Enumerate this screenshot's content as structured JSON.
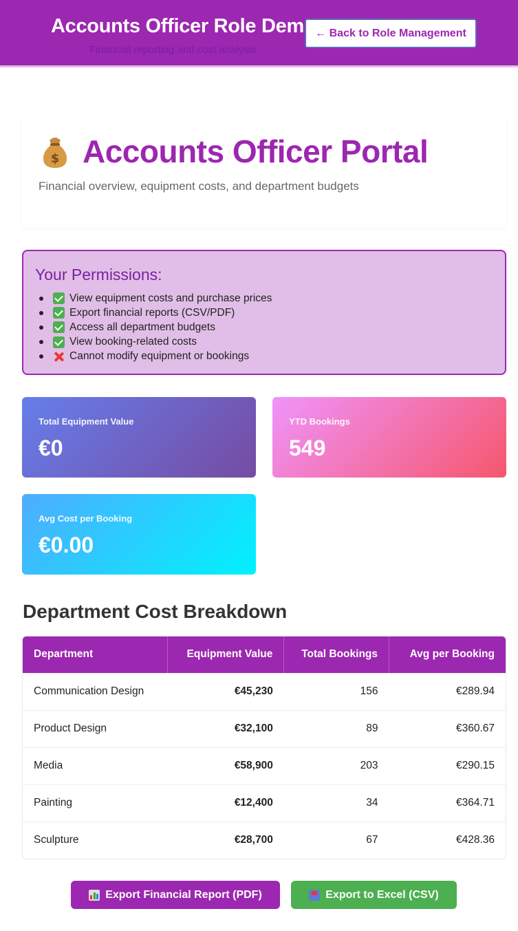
{
  "header": {
    "title": "Accounts Officer Role Demo",
    "subtitle": "Financial reporting and cost analysis",
    "back_button": "← Back to Role Management"
  },
  "portal": {
    "icon": "money-bag-icon",
    "title": "Accounts Officer Portal",
    "subtitle": "Financial overview, equipment costs, and department budgets"
  },
  "permissions": {
    "heading": "Your Permissions:",
    "items": [
      {
        "icon": "check-icon",
        "text": "View equipment costs and purchase prices"
      },
      {
        "icon": "check-icon",
        "text": "Export financial reports (CSV/PDF)"
      },
      {
        "icon": "check-icon",
        "text": "Access all department budgets"
      },
      {
        "icon": "check-icon",
        "text": "View booking-related costs"
      },
      {
        "icon": "cross-icon",
        "text": "Cannot modify equipment or bookings"
      }
    ]
  },
  "stats": [
    {
      "label": "Total Equipment Value",
      "value": "€0",
      "gradient": [
        "#667eea",
        "#764ba2"
      ]
    },
    {
      "label": "YTD Bookings",
      "value": "549",
      "gradient": [
        "#f093fb",
        "#f5576c"
      ]
    },
    {
      "label": "Avg Cost per Booking",
      "value": "€0.00",
      "gradient": [
        "#4facfe",
        "#00f2fe"
      ]
    }
  ],
  "breakdown": {
    "title": "Department Cost Breakdown",
    "columns": [
      "Department",
      "Equipment Value",
      "Total Bookings",
      "Avg per Booking"
    ],
    "rows": [
      [
        "Communication Design",
        "€45,230",
        "156",
        "€289.94"
      ],
      [
        "Product Design",
        "€32,100",
        "89",
        "€360.67"
      ],
      [
        "Media",
        "€58,900",
        "203",
        "€290.15"
      ],
      [
        "Painting",
        "€12,400",
        "34",
        "€364.71"
      ],
      [
        "Sculpture",
        "€28,700",
        "67",
        "€428.36"
      ]
    ]
  },
  "actions": {
    "export_pdf": "Export Financial Report (PDF)",
    "export_pdf_icon": "bar-chart-icon",
    "export_csv": "Export to Excel (CSV)",
    "export_csv_icon": "inbox-tray-icon"
  },
  "colors": {
    "primary": "#9c27b0",
    "primary_light": "#e1bee7",
    "success": "#4caf50",
    "danger": "#e53935"
  }
}
